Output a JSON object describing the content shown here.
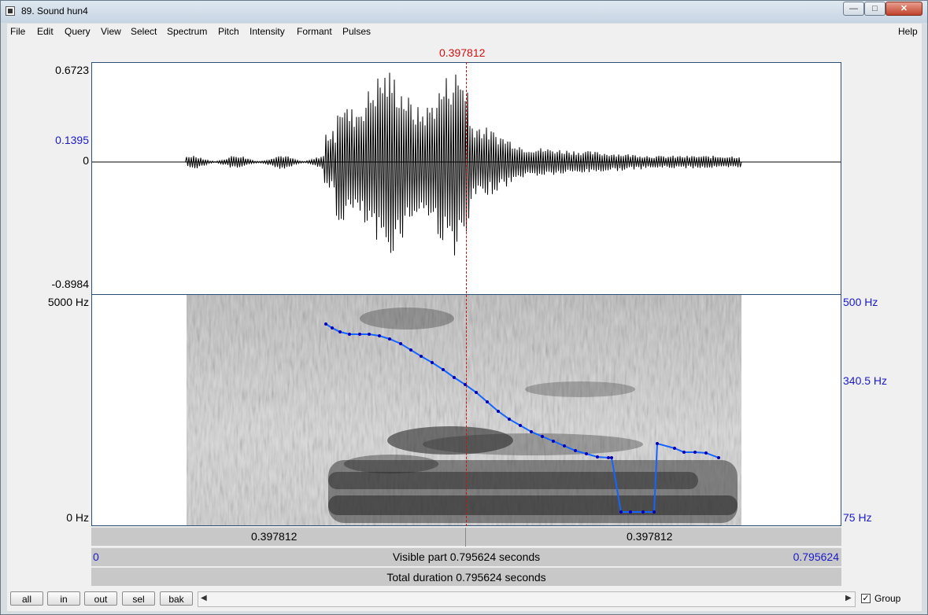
{
  "window": {
    "title": "89. Sound hun4",
    "minimize_glyph": "—",
    "maximize_glyph": "□",
    "close_glyph": "✕"
  },
  "menu": {
    "items": [
      "File",
      "Edit",
      "Query",
      "View",
      "Select",
      "Spectrum",
      "Pitch",
      "Intensity",
      "Formant",
      "Pulses"
    ],
    "help": "Help"
  },
  "cursor": {
    "time_label": "0.397812"
  },
  "waveform": {
    "max_label": "0.6723",
    "cursor_amp_label": "0.1395",
    "zero_label": "0",
    "min_label": "-0.8984"
  },
  "spectrogram": {
    "freq_top": "5000 Hz",
    "freq_bottom": "0 Hz",
    "pitch_top": "500 Hz",
    "pitch_mid": "340.5 Hz",
    "pitch_bottom": "75 Hz",
    "colors": {
      "pitch_line": "#1464ff",
      "pitch_point": "#0000b4",
      "cursor": "#d01010"
    }
  },
  "bars": {
    "left_segment": "0.397812",
    "right_segment": "0.397812",
    "visible_start": "0",
    "visible_text": "Visible part 0.795624 seconds",
    "visible_end": "0.795624",
    "total_text": "Total duration 0.795624 seconds"
  },
  "buttons": {
    "all": "all",
    "in": "in",
    "out": "out",
    "sel": "sel",
    "bak": "bak"
  },
  "scrollbar": {
    "left_arrow": "◀",
    "right_arrow": "▶"
  },
  "group": {
    "checked": true,
    "check_glyph": "✓",
    "label": "Group"
  }
}
